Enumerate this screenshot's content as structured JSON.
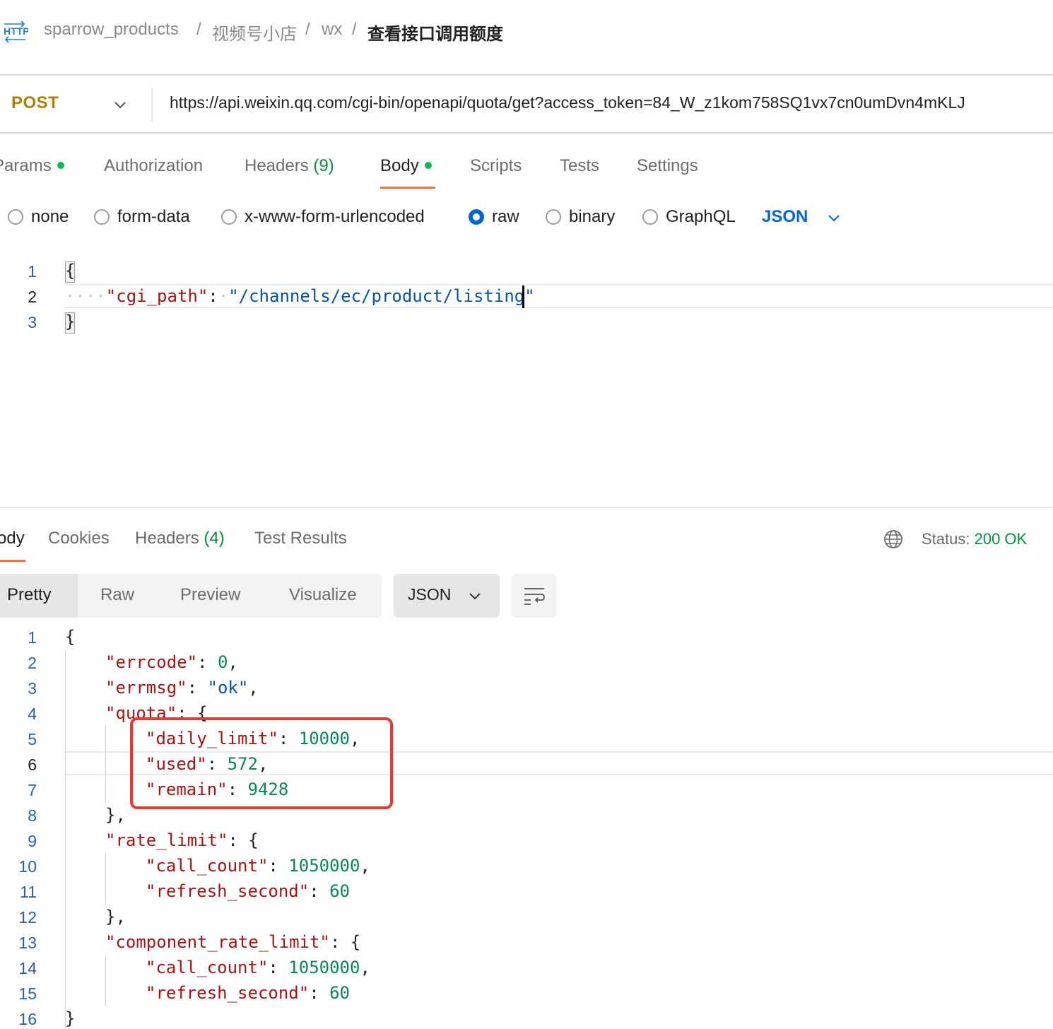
{
  "breadcrumb": {
    "icon": "http-icon",
    "items": [
      "sparrow_products",
      "视频号小店",
      "wx"
    ],
    "separator": "/",
    "current": "查看接口调用额度"
  },
  "request": {
    "method": "POST",
    "url": "https://api.weixin.qq.com/cgi-bin/openapi/quota/get?access_token=84_W_z1kom758SQ1vx7cn0umDvn4mKLJ"
  },
  "request_tabs": [
    {
      "label": "Params",
      "dot": true
    },
    {
      "label": "Authorization"
    },
    {
      "label": "Headers",
      "count": "(9)"
    },
    {
      "label": "Body",
      "dot": true,
      "active": true
    },
    {
      "label": "Scripts"
    },
    {
      "label": "Tests"
    },
    {
      "label": "Settings"
    }
  ],
  "body_types": {
    "options": [
      "none",
      "form-data",
      "x-www-form-urlencoded",
      "raw",
      "binary",
      "GraphQL"
    ],
    "selected": "raw",
    "language": "JSON"
  },
  "request_body": {
    "line_numbers": [
      "1",
      "2",
      "3"
    ],
    "open": "{",
    "key": "\"cgi_path\"",
    "colon": ":",
    "value": "\"/channels/ec/product/listing\"",
    "close": "}"
  },
  "response_tabs": [
    {
      "label": "Body",
      "active": true
    },
    {
      "label": "Cookies"
    },
    {
      "label": "Headers",
      "count": "(4)"
    },
    {
      "label": "Test Results"
    }
  ],
  "status": {
    "label": "Status:",
    "value": "200 OK"
  },
  "view_modes": {
    "options": [
      "Pretty",
      "Raw",
      "Preview",
      "Visualize"
    ],
    "selected": "Pretty",
    "language": "JSON"
  },
  "response_body": {
    "line_numbers": [
      "1",
      "2",
      "3",
      "4",
      "5",
      "6",
      "7",
      "8",
      "9",
      "10",
      "11",
      "12",
      "13",
      "14",
      "15",
      "16"
    ],
    "lines": [
      {
        "t": "{"
      },
      {
        "k": "\"errcode\"",
        "n": "0",
        "end": ","
      },
      {
        "k": "\"errmsg\"",
        "s": "\"ok\"",
        "end": ","
      },
      {
        "k": "\"quota\"",
        "end": ": {"
      },
      {
        "k": "\"daily_limit\"",
        "n": "10000",
        "end": ","
      },
      {
        "k": "\"used\"",
        "n": "572",
        "end": ","
      },
      {
        "k": "\"remain\"",
        "n": "9428"
      },
      {
        "t": "},"
      },
      {
        "k": "\"rate_limit\"",
        "end": ": {"
      },
      {
        "k": "\"call_count\"",
        "n": "1050000",
        "end": ","
      },
      {
        "k": "\"refresh_second\"",
        "n": "60"
      },
      {
        "t": "},"
      },
      {
        "k": "\"component_rate_limit\"",
        "end": ": {"
      },
      {
        "k": "\"call_count\"",
        "n": "1050000",
        "end": ","
      },
      {
        "k": "\"refresh_second\"",
        "n": "60"
      },
      {
        "t": "}"
      }
    ]
  },
  "colors": {
    "method": "#a7830d",
    "accent_tab": "#ff6c37",
    "status_ok": "#0a8b3c",
    "highlight_box": "#e53935",
    "json_key": "#a31515",
    "json_string": "#0451a5",
    "json_number": "#098658"
  }
}
